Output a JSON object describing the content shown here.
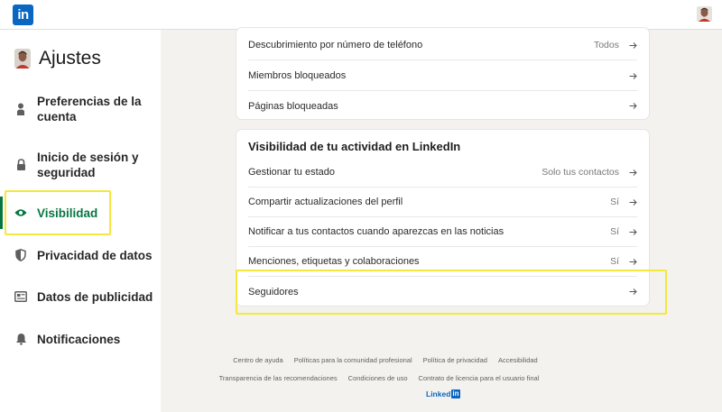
{
  "app": {
    "logo_text": "in"
  },
  "sidebar": {
    "title": "Ajustes",
    "items": [
      {
        "label": "Preferencias de la cuenta",
        "icon": "person-icon",
        "active": false
      },
      {
        "label": "Inicio de sesión y seguridad",
        "icon": "lock-icon",
        "active": false
      },
      {
        "label": "Visibilidad",
        "icon": "eye-icon",
        "active": true
      },
      {
        "label": "Privacidad de datos",
        "icon": "shield-icon",
        "active": false
      },
      {
        "label": "Datos de publicidad",
        "icon": "newspaper-icon",
        "active": false
      },
      {
        "label": "Notificaciones",
        "icon": "bell-icon",
        "active": false
      }
    ]
  },
  "card_top": {
    "rows": [
      {
        "label": "Descubrimiento por número de teléfono",
        "value": "Todos"
      },
      {
        "label": "Miembros bloqueados",
        "value": ""
      },
      {
        "label": "Páginas bloqueadas",
        "value": ""
      }
    ]
  },
  "card_activity": {
    "title": "Visibilidad de tu actividad en LinkedIn",
    "rows": [
      {
        "label": "Gestionar tu estado",
        "value": "Solo tus contactos"
      },
      {
        "label": "Compartir actualizaciones del perfil",
        "value": "Sí"
      },
      {
        "label": "Notificar a tus contactos cuando aparezcas en las noticias",
        "value": "Sí"
      },
      {
        "label": "Menciones, etiquetas y colaboraciones",
        "value": "Sí"
      },
      {
        "label": "Seguidores",
        "value": ""
      }
    ]
  },
  "footer": {
    "row1": [
      "Centro de ayuda",
      "Políticas para la comunidad profesional",
      "Política de privacidad",
      "Accesibilidad"
    ],
    "row2": [
      "Transparencia de las recomendaciones",
      "Condiciones de uso",
      "Contrato de licencia para el usuario final"
    ],
    "logo_word": "Linked",
    "logo_in": "in"
  },
  "colors": {
    "brand": "#0a66c2",
    "active_green": "#057642",
    "highlight": "#f5e73c",
    "background": "#f3f2ef"
  }
}
